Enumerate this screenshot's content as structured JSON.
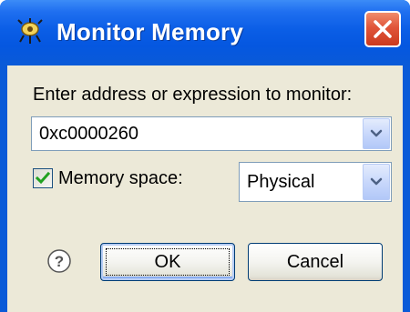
{
  "window": {
    "title": "Monitor Memory",
    "title_icon": "eclipse-monitor-icon",
    "close_icon": "close-icon"
  },
  "form": {
    "prompt_label": "Enter address or expression to monitor:",
    "address": {
      "value": "0xc0000260",
      "dropdown_icon": "chevron-down-icon"
    },
    "memory_space": {
      "checked": true,
      "label": "Memory space:",
      "selected": "Physical",
      "dropdown_icon": "chevron-down-icon"
    }
  },
  "buttons": {
    "help_icon": "help-question-icon",
    "ok_label": "OK",
    "cancel_label": "Cancel"
  },
  "colors": {
    "titlebar": "#0a5ad8",
    "dialog_background": "#ece9d8",
    "close_button": "#e0553a",
    "checkmark": "#21a121",
    "combo_arrow": "#4d6185"
  }
}
